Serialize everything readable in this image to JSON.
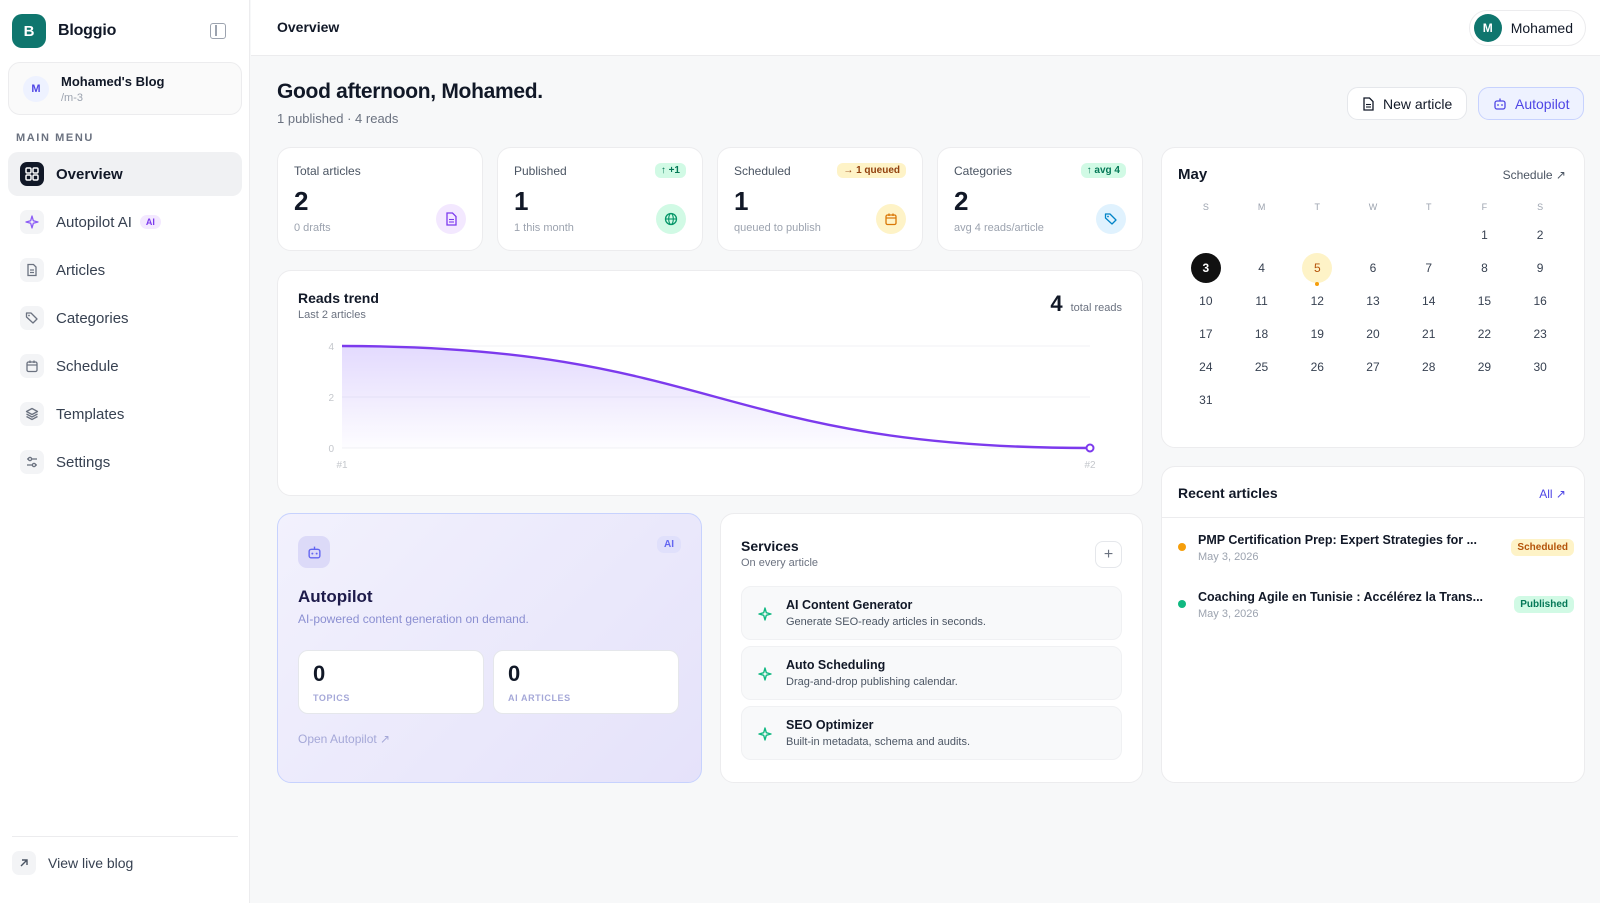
{
  "app": {
    "name": "Bloggio",
    "logo_letter": "B"
  },
  "blog": {
    "avatar": "M",
    "name": "Mohamed's Blog",
    "slug": "/m-3"
  },
  "sidebar": {
    "section_title": "MAIN MENU",
    "items": [
      {
        "label": "Overview",
        "icon": "grid-icon",
        "active": true
      },
      {
        "label": "Autopilot AI",
        "icon": "sparkle-icon",
        "badge": "AI"
      },
      {
        "label": "Articles",
        "icon": "document-icon"
      },
      {
        "label": "Categories",
        "icon": "tags-icon"
      },
      {
        "label": "Schedule",
        "icon": "calendar-icon"
      },
      {
        "label": "Templates",
        "icon": "layers-icon"
      },
      {
        "label": "Settings",
        "icon": "sliders-icon"
      }
    ],
    "footer": "View live blog"
  },
  "header": {
    "title": "Overview",
    "user_avatar": "M",
    "user_name": "Mohamed"
  },
  "greeting": {
    "title": "Good afternoon, Mohamed.",
    "subtitle": "1 published · 4 reads"
  },
  "actions": {
    "new_article": "New article",
    "autopilot": "Autopilot"
  },
  "stats": [
    {
      "label": "Total articles",
      "value": "2",
      "sub": "0 drafts",
      "badge": "",
      "icon": "document-icon",
      "color": "#7c3aed"
    },
    {
      "label": "Published",
      "value": "1",
      "sub": "1 this month",
      "badge": "↑ +1",
      "icon": "globe-icon",
      "color": "#10b981"
    },
    {
      "label": "Scheduled",
      "value": "1",
      "sub": "queued to publish",
      "badge": "→ 1 queued",
      "icon": "calendar-icon",
      "color": "#f59e0b"
    },
    {
      "label": "Categories",
      "value": "2",
      "sub": "avg 4 reads/article",
      "badge": "↑ avg 4",
      "icon": "tag-icon",
      "color": "#0ea5e9"
    }
  ],
  "chart": {
    "title": "Reads trend",
    "subtitle": "Last 2 articles",
    "total_value": "4",
    "total_label": "total reads"
  },
  "chart_data": {
    "type": "area",
    "title": "Reads trend",
    "x": [
      "#1",
      "#2"
    ],
    "series": [
      {
        "values": [
          4,
          0
        ]
      }
    ],
    "yticks": [
      "0",
      "2",
      "4"
    ],
    "ylim": [
      0,
      4
    ],
    "grid": true,
    "color": "#7c3aed"
  },
  "calendar": {
    "month": "May",
    "schedule_link": "Schedule ↗",
    "weekdays": [
      "S",
      "M",
      "T",
      "W",
      "T",
      "F",
      "S"
    ],
    "start_offset": 5,
    "days": [
      "1",
      "2",
      "3",
      "4",
      "5",
      "6",
      "7",
      "8",
      "9",
      "10",
      "11",
      "12",
      "13",
      "14",
      "15",
      "16",
      "17",
      "18",
      "19",
      "20",
      "21",
      "22",
      "23",
      "24",
      "25",
      "26",
      "27",
      "28",
      "29",
      "30",
      "31"
    ],
    "today": "3",
    "marked": "5"
  },
  "autopilot": {
    "badge": "AI",
    "title": "Autopilot",
    "description": "AI-powered content generation on demand.",
    "topics_value": "0",
    "topics_label": "TOPICS",
    "articles_value": "0",
    "articles_label": "AI ARTICLES",
    "link": "Open Autopilot ↗"
  },
  "services": {
    "title": "Services",
    "subtitle": "On every article",
    "plus": "+",
    "items": [
      {
        "name": "AI Content Generator",
        "desc": "Generate SEO-ready articles in seconds."
      },
      {
        "name": "Auto Scheduling",
        "desc": "Drag-and-drop publishing calendar."
      },
      {
        "name": "SEO Optimizer",
        "desc": "Built-in metadata, schema and audits."
      }
    ]
  },
  "recent": {
    "title": "Recent articles",
    "all_link": "All ↗",
    "items": [
      {
        "title": "PMP Certification Prep: Expert Strategies for ...",
        "date": "May 3, 2026",
        "status": "Scheduled",
        "dot": "#f59e0b",
        "status_bg": "#fef3c7",
        "status_fg": "#b45309"
      },
      {
        "title": "Coaching Agile en Tunisie : Accélérez la Trans...",
        "date": "May 3, 2026",
        "status": "Published",
        "dot": "#10b981",
        "status_bg": "#d1fae5",
        "status_fg": "#047857"
      }
    ]
  }
}
